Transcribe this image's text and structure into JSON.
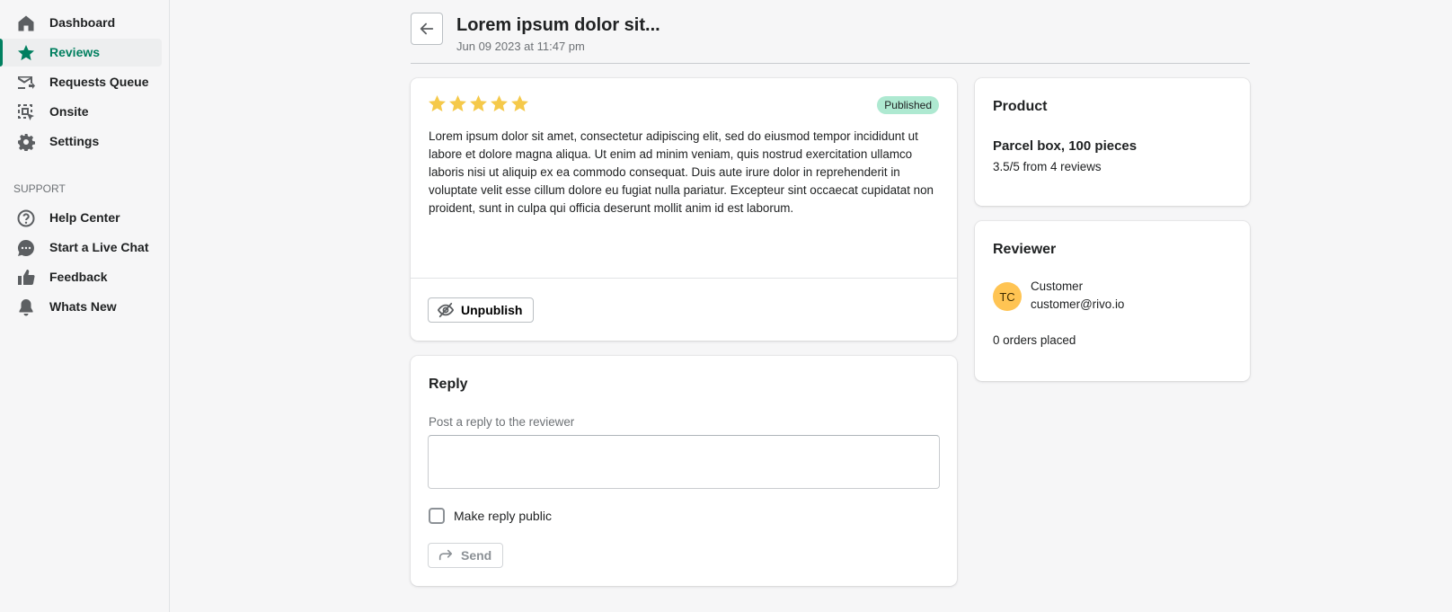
{
  "sidebar": {
    "items": [
      {
        "label": "Dashboard",
        "icon": "home-icon"
      },
      {
        "label": "Reviews",
        "icon": "star-icon",
        "active": true
      },
      {
        "label": "Requests Queue",
        "icon": "mail-forward-icon"
      },
      {
        "label": "Onsite",
        "icon": "onsite-select-icon"
      },
      {
        "label": "Settings",
        "icon": "gear-icon"
      }
    ],
    "support_heading": "SUPPORT",
    "support_items": [
      {
        "label": "Help Center",
        "icon": "question-circle-icon"
      },
      {
        "label": "Start a Live Chat",
        "icon": "chat-bubble-icon"
      },
      {
        "label": "Feedback",
        "icon": "thumbs-up-icon"
      },
      {
        "label": "Whats New",
        "icon": "bell-icon"
      }
    ]
  },
  "header": {
    "title": "Lorem ipsum dolor sit...",
    "subtitle": "Jun 09 2023 at 11:47 pm"
  },
  "review": {
    "rating": 5,
    "max_rating": 5,
    "status": "Published",
    "text": "Lorem ipsum dolor sit amet, consectetur adipiscing elit, sed do eiusmod tempor incididunt ut labore et dolore magna aliqua. Ut enim ad minim veniam, quis nostrud exercitation ullamco laboris nisi ut aliquip ex ea commodo consequat. Duis aute irure dolor in reprehenderit in voluptate velit esse cillum dolore eu fugiat nulla pariatur. Excepteur sint occaecat cupidatat non proident, sunt in culpa qui officia deserunt mollit anim id est laborum.",
    "unpublish_label": "Unpublish"
  },
  "reply": {
    "title": "Reply",
    "label": "Post a reply to the reviewer",
    "value": "",
    "make_public_label": "Make reply public",
    "make_public_checked": false,
    "send_label": "Send"
  },
  "product": {
    "title": "Product",
    "name": "Parcel box, 100 pieces",
    "rating_summary": "3.5/5 from 4 reviews"
  },
  "reviewer": {
    "title": "Reviewer",
    "initials": "TC",
    "name": "Customer",
    "email": "customer@rivo.io",
    "orders": "0 orders placed"
  },
  "colors": {
    "accent": "#008060",
    "active_text": "#007f5f",
    "star": "#f5c94a",
    "badge_bg": "#aee9d1",
    "avatar_bg": "#ffc453"
  }
}
